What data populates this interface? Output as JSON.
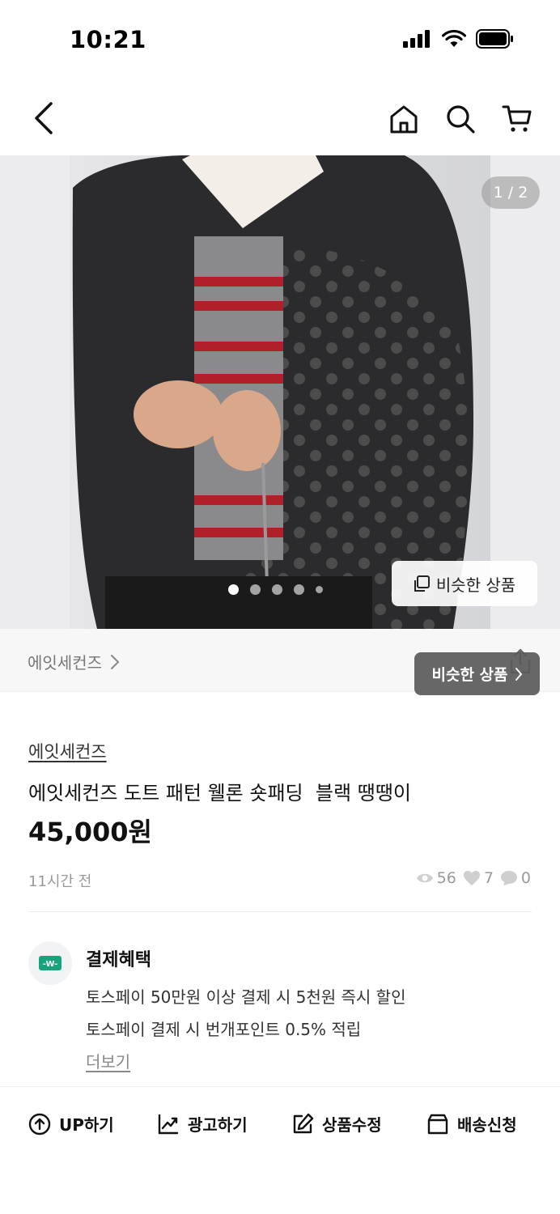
{
  "status_bar": {
    "time": "10:21"
  },
  "image": {
    "page_indicator": "1 / 2",
    "similar_button_label": "비슷한 상품",
    "dots_count": 5,
    "active_dot": 0
  },
  "shop": {
    "name": "에잇세컨즈",
    "tooltip_label": "비슷한 상품"
  },
  "product": {
    "store": "에잇세컨즈",
    "title": "에잇세컨즈 도트 패턴 웰론 숏패딩  블랙 땡땡이",
    "price": "45,000원",
    "posted": "11시간 전",
    "views": "56",
    "likes": "7",
    "chats": "0"
  },
  "benefits": {
    "title": "결제혜택",
    "line1": "토스페이 50만원 이상 결제 시 5천원 즉시 할인",
    "line2": "토스페이 결제 시 번개포인트 0.5% 적립",
    "more": "더보기"
  },
  "actions": {
    "up": "UP하기",
    "ad": "광고하기",
    "edit": "상품수정",
    "ship": "배송신청"
  },
  "colors": {
    "tooltip_bg": "#5a5a5a",
    "benefit_icon": "#1aa37a"
  }
}
